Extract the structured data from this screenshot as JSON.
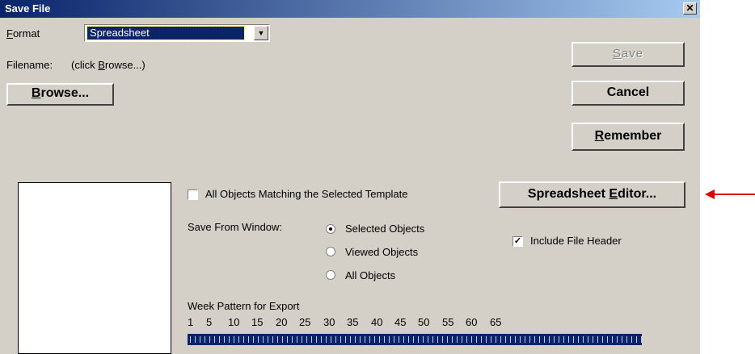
{
  "window": {
    "title": "Save File",
    "close_glyph": "✕"
  },
  "format": {
    "label_prefix": "",
    "label_mnemonic": "F",
    "label_rest": "ormat",
    "value": "Spreadsheet"
  },
  "filename": {
    "label": "Filename:",
    "value_prefix": "(click ",
    "value_mnemonic": "B",
    "value_rest": "rowse...)"
  },
  "buttons": {
    "browse": {
      "mnemonic": "B",
      "rest": "rowse..."
    },
    "save": {
      "mnemonic": "S",
      "rest": "ave",
      "disabled": true
    },
    "cancel": {
      "label": "Cancel"
    },
    "remember": {
      "mnemonic": "R",
      "rest": "emember"
    },
    "spreadsheet_editor": {
      "prefix": "Spreadsheet ",
      "mnemonic": "E",
      "rest": "ditor..."
    }
  },
  "options": {
    "all_objects_matching": {
      "label": "All Objects Matching the Selected Template",
      "checked": false
    },
    "include_file_header": {
      "label": "Include File Header",
      "checked": true
    }
  },
  "save_from_window": {
    "label": "Save From Window:",
    "choices": [
      {
        "label": "Selected Objects",
        "selected": true
      },
      {
        "label": "Viewed Objects",
        "selected": false
      },
      {
        "label": "All Objects",
        "selected": false
      }
    ]
  },
  "week_pattern": {
    "label": "Week Pattern for Export",
    "numbers": [
      "1",
      "5",
      "10",
      "15",
      "20",
      "25",
      "30",
      "35",
      "40",
      "45",
      "50",
      "55",
      "60",
      "65"
    ]
  },
  "annotation": {
    "arrow_color": "#e00000"
  }
}
